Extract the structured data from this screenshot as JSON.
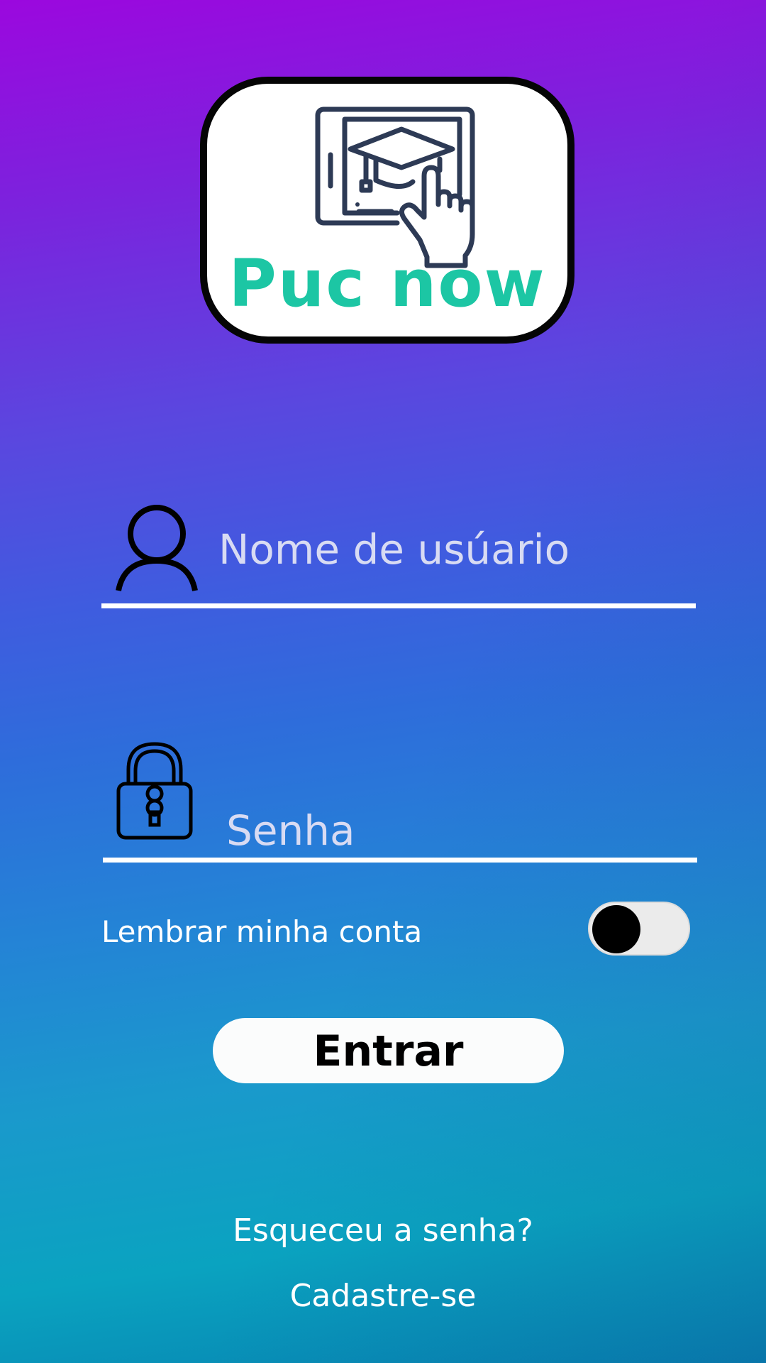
{
  "logo": {
    "text": "Puc now",
    "icon": "graduation-tablet-touch-icon",
    "text_color": "#1cc6a4",
    "line_color": "#2d3a55"
  },
  "login_form": {
    "username_placeholder": "Nome de usúario",
    "username_value": "",
    "username_icon": "user-icon",
    "password_placeholder": "Senha",
    "password_value": "",
    "password_icon": "lock-icon",
    "remember_label": "Lembrar minha conta",
    "remember_on": false,
    "submit_label": "Entrar"
  },
  "links": {
    "forgot_password": "Esqueceu a senha?",
    "sign_up": "Cadastre-se"
  },
  "colors": {
    "gradient_top": "#9b08de",
    "gradient_middle": "#3f5cdf",
    "gradient_bottom": "#0aa3c0",
    "field_line": "#ffffff",
    "button_background": "#fbfcfc"
  }
}
